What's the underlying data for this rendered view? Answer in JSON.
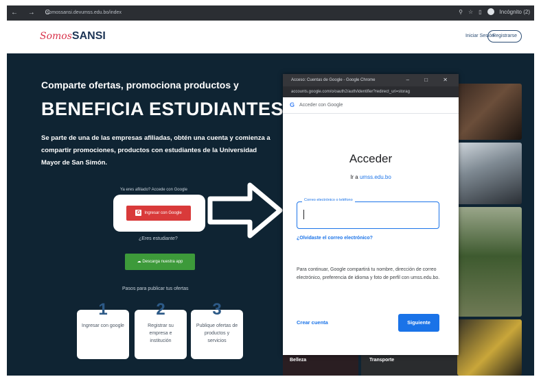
{
  "browser": {
    "nav_icons": "← → C",
    "url": "somossansi.devumss.edu.bo/index",
    "incognito_label": "Incógnito (2)"
  },
  "header": {
    "logo_script": "Somos",
    "logo_bold": "SANSI",
    "login_label": "Iniciar Sesión",
    "register_label": "Registrarse"
  },
  "hero": {
    "kicker": "Comparte ofertas, promociona productos y",
    "title": "BENEFICIA ESTUDIANTES",
    "description": "Se parte de una de las empresas afiliadas, obtén una cuenta y comienza a compartir promociones, productos con estudiantes de la Universidad Mayor de San Simón.",
    "google_note": "Ya eres afiliado? Accede con Google",
    "google_button": "Ingresar con Google",
    "student_question": "¿Eres estudiante?",
    "download_button": "Descarga nuestra app",
    "steps_title": "Pasos para publicar tus ofertas"
  },
  "steps": [
    {
      "number": "1",
      "text": "Ingresar con google"
    },
    {
      "number": "2",
      "text": "Registrar su empresa e institución"
    },
    {
      "number": "3",
      "text": "Publique ofertas de productos y servicios"
    }
  ],
  "image_labels": {
    "left": "Belleza",
    "right": "Transporte"
  },
  "popup": {
    "window_title": "Acceso: Cuentas de Google - Google Chrome",
    "url": "accounts.google.com/o/oauth2/auth/identifier?redirect_uri=storag",
    "header_label": "Acceder con Google",
    "heading": "Acceder",
    "subtitle_prefix": "Ir a",
    "subtitle_domain": "umss.edu.bo",
    "email_label": "Correo electrónico o teléfono",
    "forgot_link": "¿Olvidaste el correo electrónico?",
    "notice": "Para continuar, Google compartirá tu nombre, dirección de correo electrónico, preferencia de idioma y foto de perfil con umss.edu.bo.",
    "create_account": "Crear cuenta",
    "next_button": "Siguiente"
  },
  "colors": {
    "hero_bg": "#0f2433",
    "google_red": "#d93a3a",
    "download_green": "#3d9a3a",
    "google_blue": "#1a73e8"
  }
}
